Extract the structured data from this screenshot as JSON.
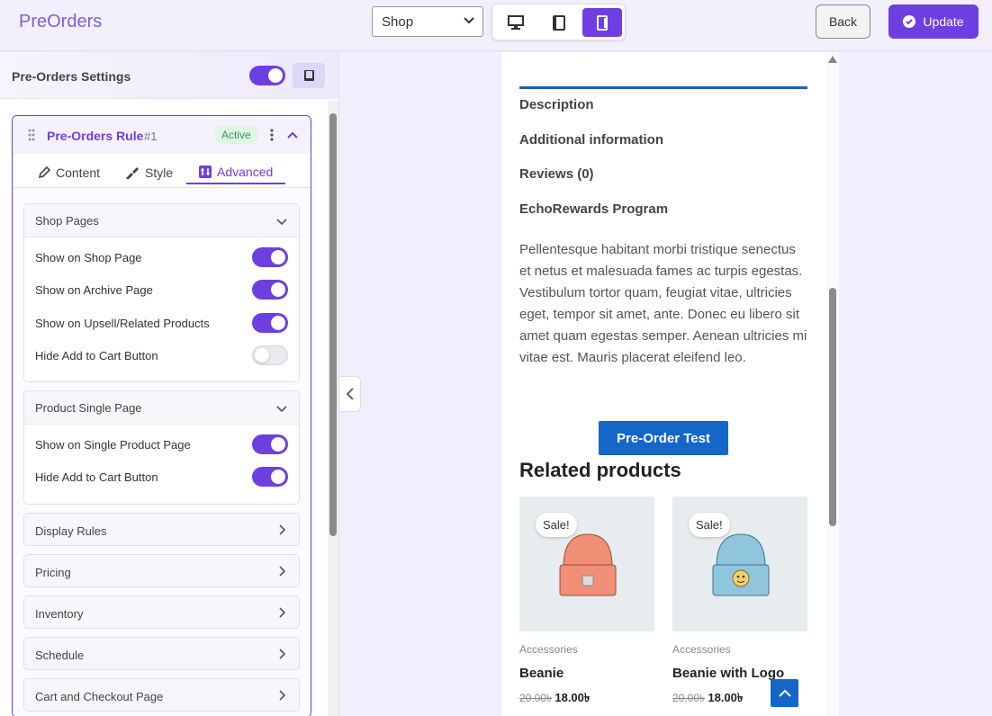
{
  "app": {
    "title": "PreOrders"
  },
  "header": {
    "page_select": "Shop",
    "back_label": "Back",
    "update_label": "Update",
    "accent": "#6e3fe0"
  },
  "settings": {
    "title": "Pre-Orders Settings",
    "enabled": true
  },
  "rule": {
    "title": "Pre-Orders Rule",
    "number": "#1",
    "status": "Active",
    "tabs": [
      "Content",
      "Style",
      "Advanced"
    ],
    "active_tab": "Advanced"
  },
  "shop_pages": {
    "title": "Shop Pages",
    "items": [
      {
        "label": "Show on Shop Page",
        "on": true
      },
      {
        "label": "Show on Archive Page",
        "on": true
      },
      {
        "label": "Show on Upsell/Related Products",
        "on": true
      },
      {
        "label": "Hide Add to Cart Button",
        "on": false
      }
    ]
  },
  "single_page": {
    "title": "Product Single Page",
    "items": [
      {
        "label": "Show on Single Product Page",
        "on": true
      },
      {
        "label": "Hide Add to Cart Button",
        "on": true
      }
    ]
  },
  "collapsed_sections": [
    "Display Rules",
    "Pricing",
    "Inventory",
    "Schedule",
    "Cart and Checkout Page"
  ],
  "preview": {
    "tabs": [
      "Description",
      "Additional information",
      "Reviews (0)",
      "EchoRewards Program"
    ],
    "description": "Pellentesque habitant morbi tristique senectus et netus et malesuada fames ac turpis egestas. Vestibulum tortor quam, feugiat vitae, ultricies eget, tempor sit amet, ante. Donec eu libero sit amet quam egestas semper. Aenean ultricies mi vitae est. Mauris placerat eleifend leo.",
    "button": "Pre-Order Test",
    "related_title": "Related products",
    "products": [
      {
        "sale": "Sale!",
        "category": "Accessories",
        "name": "Beanie",
        "old_price": "20.00৳",
        "price": "18.00৳"
      },
      {
        "sale": "Sale!",
        "category": "Accessories",
        "name": "Beanie with Logo",
        "old_price": "20.00৳",
        "price": "18.00৳"
      }
    ]
  }
}
